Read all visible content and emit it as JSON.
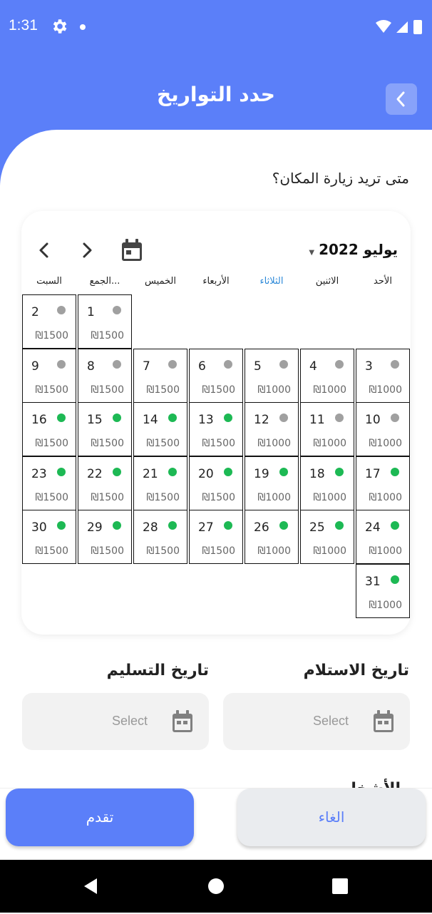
{
  "status_bar": {
    "time": "1:31"
  },
  "header": {
    "title": "حدد التواريخ"
  },
  "question": "متى تريد زيارة المكان؟",
  "calendar": {
    "month_label": "يوليو 2022",
    "weekdays": [
      "الأحد",
      "الاثنين",
      "الثلاثاء",
      "الأربعاء",
      "الخميس",
      "الجمع...",
      "السبت"
    ],
    "active_weekday_index": 2,
    "days": [
      {
        "num": "1",
        "price": "₪1500",
        "status": "gray"
      },
      {
        "num": "2",
        "price": "₪1500",
        "status": "gray"
      },
      {
        "num": "3",
        "price": "₪1000",
        "status": "gray"
      },
      {
        "num": "4",
        "price": "₪1000",
        "status": "gray"
      },
      {
        "num": "5",
        "price": "₪1000",
        "status": "gray"
      },
      {
        "num": "6",
        "price": "₪1500",
        "status": "gray"
      },
      {
        "num": "7",
        "price": "₪1500",
        "status": "gray"
      },
      {
        "num": "8",
        "price": "₪1500",
        "status": "gray"
      },
      {
        "num": "9",
        "price": "₪1500",
        "status": "gray"
      },
      {
        "num": "10",
        "price": "₪1000",
        "status": "gray"
      },
      {
        "num": "11",
        "price": "₪1000",
        "status": "gray"
      },
      {
        "num": "12",
        "price": "₪1000",
        "status": "gray"
      },
      {
        "num": "13",
        "price": "₪1500",
        "status": "green"
      },
      {
        "num": "14",
        "price": "₪1500",
        "status": "green"
      },
      {
        "num": "15",
        "price": "₪1500",
        "status": "green"
      },
      {
        "num": "16",
        "price": "₪1500",
        "status": "green"
      },
      {
        "num": "17",
        "price": "₪1000",
        "status": "green"
      },
      {
        "num": "18",
        "price": "₪1000",
        "status": "green"
      },
      {
        "num": "19",
        "price": "₪1000",
        "status": "green"
      },
      {
        "num": "20",
        "price": "₪1500",
        "status": "green"
      },
      {
        "num": "21",
        "price": "₪1500",
        "status": "green"
      },
      {
        "num": "22",
        "price": "₪1500",
        "status": "green"
      },
      {
        "num": "23",
        "price": "₪1500",
        "status": "green"
      },
      {
        "num": "24",
        "price": "₪1000",
        "status": "green"
      },
      {
        "num": "25",
        "price": "₪1000",
        "status": "green"
      },
      {
        "num": "26",
        "price": "₪1000",
        "status": "green"
      },
      {
        "num": "27",
        "price": "₪1500",
        "status": "green"
      },
      {
        "num": "28",
        "price": "₪1500",
        "status": "green"
      },
      {
        "num": "29",
        "price": "₪1500",
        "status": "green"
      },
      {
        "num": "30",
        "price": "₪1500",
        "status": "green"
      },
      {
        "num": "31",
        "price": "₪1000",
        "status": "green"
      }
    ],
    "first_weekday_index": 5
  },
  "colors": {
    "primary": "#5b7ff9",
    "available": "#1db954",
    "unavailable": "#a0a0a0",
    "active_weekday": "#2b88d8"
  },
  "checkin": {
    "label": "تاريخ الاستلام",
    "placeholder": "Select",
    "icon": "calendar-icon"
  },
  "checkout": {
    "label": "تاريخ التسليم",
    "placeholder": "Select",
    "icon": "calendar-icon"
  },
  "next_section_partial": "الأشخا",
  "buttons": {
    "proceed": "تقدم",
    "cancel": "الغاء"
  }
}
